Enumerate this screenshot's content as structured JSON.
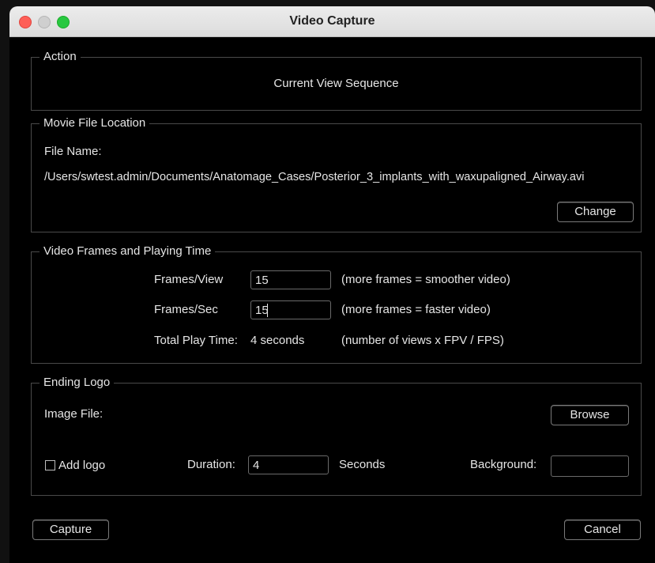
{
  "window": {
    "title": "Video Capture"
  },
  "action": {
    "legend": "Action",
    "value": "Current View Sequence"
  },
  "movie": {
    "legend": "Movie File Location",
    "file_name_label": "File Name:",
    "path": "/Users/swtest.admin/Documents/Anatomage_Cases/Posterior_3_implants_with_waxupaligned_Airway.avi",
    "change_label": "Change"
  },
  "frames": {
    "legend": "Video Frames and Playing Time",
    "fpv_label": "Frames/View",
    "fpv_value": "15",
    "fpv_hint": "(more frames = smoother video)",
    "fps_label": "Frames/Sec",
    "fps_value": "15",
    "fps_hint": "(more frames = faster video)",
    "total_label": "Total Play Time:",
    "total_value": "4 seconds",
    "total_hint": "(number of views x FPV / FPS)"
  },
  "logo": {
    "legend": "Ending Logo",
    "image_label": "Image File:",
    "browse_label": "Browse",
    "add_logo_label": "Add logo",
    "duration_label": "Duration:",
    "duration_value": "4",
    "seconds_label": "Seconds",
    "background_label": "Background:",
    "background_color": "#000000"
  },
  "footer": {
    "capture_label": "Capture",
    "cancel_label": "Cancel"
  }
}
